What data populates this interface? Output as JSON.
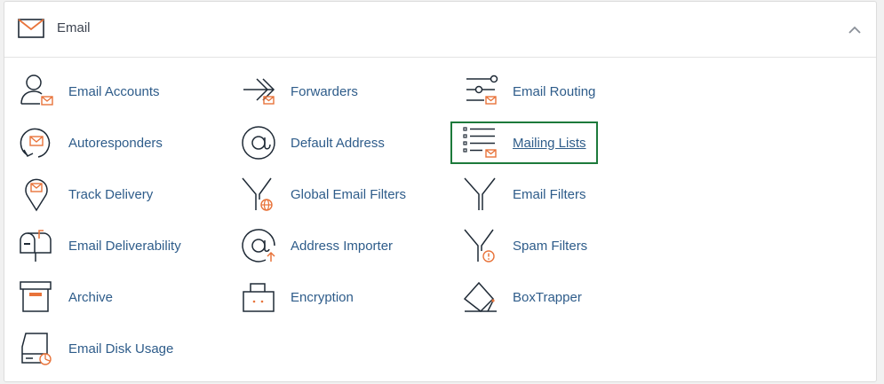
{
  "section": {
    "title": "Email",
    "collapse_icon": "chevron-up-icon"
  },
  "items": [
    {
      "label": "Email Accounts",
      "icon": "email-accounts-icon"
    },
    {
      "label": "Forwarders",
      "icon": "forwarders-icon"
    },
    {
      "label": "Email Routing",
      "icon": "email-routing-icon"
    },
    {
      "label": "Autoresponders",
      "icon": "autoresponders-icon"
    },
    {
      "label": "Default Address",
      "icon": "default-address-icon"
    },
    {
      "label": "Mailing Lists",
      "icon": "mailing-lists-icon",
      "selected": true
    },
    {
      "label": "Track Delivery",
      "icon": "track-delivery-icon"
    },
    {
      "label": "Global Email Filters",
      "icon": "global-email-filters-icon"
    },
    {
      "label": "Email Filters",
      "icon": "email-filters-icon"
    },
    {
      "label": "Email Deliverability",
      "icon": "email-deliverability-icon"
    },
    {
      "label": "Address Importer",
      "icon": "address-importer-icon"
    },
    {
      "label": "Spam Filters",
      "icon": "spam-filters-icon"
    },
    {
      "label": "Archive",
      "icon": "archive-icon"
    },
    {
      "label": "Encryption",
      "icon": "encryption-icon"
    },
    {
      "label": "BoxTrapper",
      "icon": "boxtrapper-icon"
    },
    {
      "label": "Email Disk Usage",
      "icon": "email-disk-usage-icon"
    }
  ],
  "colors": {
    "accent_orange": "#e8733a",
    "link_blue": "#2e5c8a",
    "selected_outline": "#1d7a3b",
    "icon_stroke": "#1f2a36"
  }
}
